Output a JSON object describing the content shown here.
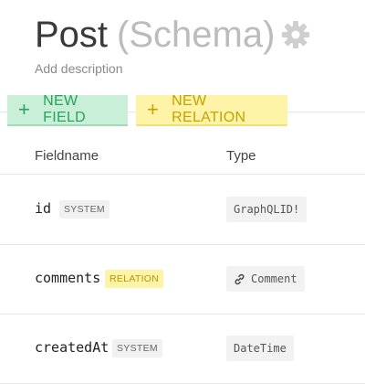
{
  "header": {
    "title": "Post",
    "subtitle": "(Schema)",
    "settings_icon": "gear-icon",
    "description_placeholder": "Add description"
  },
  "toolbar": {
    "new_field_label": "NEW FIELD",
    "new_relation_label": "NEW RELATION",
    "plus_icon": "plus-icon"
  },
  "table": {
    "columns": [
      "Fieldname",
      "Type"
    ],
    "rows": [
      {
        "name": "id",
        "badge": "SYSTEM",
        "type": "GraphQLID!"
      },
      {
        "name": "comments",
        "badge": "RELATION",
        "type": "Comment",
        "type_icon": "link-icon"
      },
      {
        "name": "createdAt",
        "badge": "SYSTEM",
        "type": "DateTime"
      }
    ]
  },
  "colors": {
    "field_button_bg": "#c9efd8",
    "field_button_text": "#27a35a",
    "relation_button_bg": "#fdf4a8",
    "relation_button_text": "#c8a000"
  }
}
